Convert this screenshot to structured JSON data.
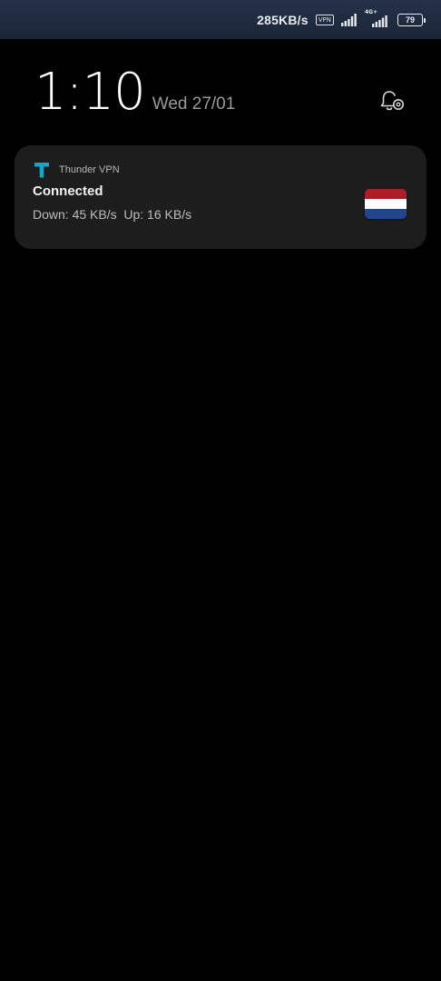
{
  "status_bar": {
    "net_speed": "285KB/s",
    "vpn_badge": "VPN",
    "network_type": "4G+",
    "battery_level": "79",
    "icons": [
      "signal-icon",
      "lte-signal-icon",
      "battery-icon"
    ]
  },
  "lock_screen": {
    "time": "1:10",
    "date": "Wed 27/01",
    "settings_icon": "notification-settings-icon"
  },
  "notification": {
    "app_name": "Thunder VPN",
    "app_icon": "thunder-vpn-icon",
    "title": "Connected",
    "body": "Down: 45 KB/s  Up: 16 KB/s",
    "flag": {
      "name": "netherlands-flag-icon",
      "colors": [
        "#ae1c28",
        "#ffffff",
        "#21468b"
      ]
    }
  },
  "colors": {
    "background": "#000000",
    "card": "#1d1d1e",
    "status_bar": "#1f2a3d",
    "app_icon_accent": "#1aa3c4"
  }
}
